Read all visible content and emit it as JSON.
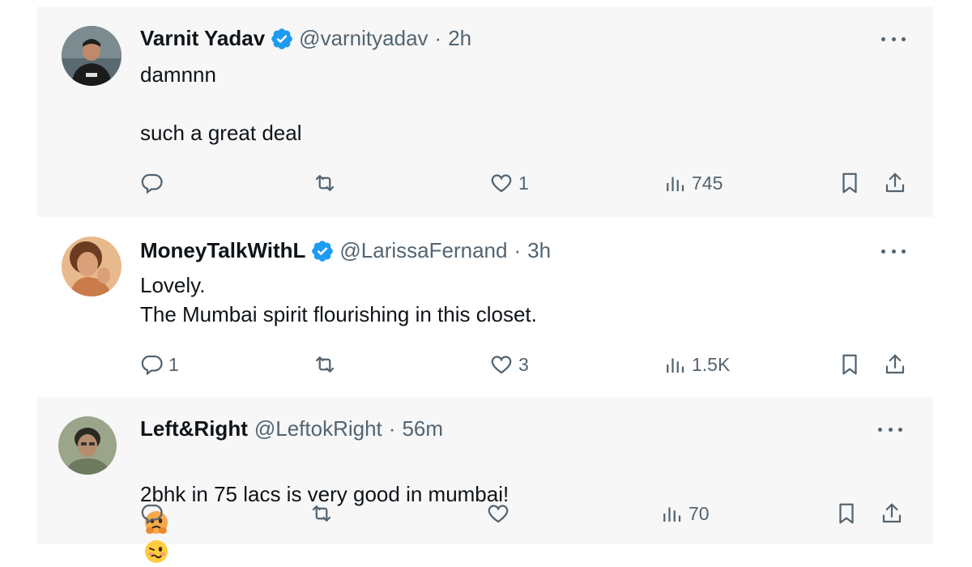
{
  "colors": {
    "text": "#0f1419",
    "secondary": "#536471",
    "verified_badge": "#1d9bf0",
    "row_bg": "#f7f7f7"
  },
  "tweets": [
    {
      "name": "Varnit Yadav",
      "verified": true,
      "handle": "@varnityadav",
      "separator": "·",
      "time": "2h",
      "text": "damnnn\n\nsuch a great deal",
      "replies": "",
      "retweets": "",
      "likes": "1",
      "views": "745",
      "avatar_icon": "person-dark-tshirt-avatar"
    },
    {
      "name": "MoneyTalkWithL",
      "verified": true,
      "handle": "@LarissaFernand",
      "separator": "·",
      "time": "3h",
      "text": "Lovely.\nThe Mumbai spirit flourishing in this closet.",
      "replies": "1",
      "retweets": "",
      "likes": "3",
      "views": "1.5K",
      "avatar_icon": "person-warm-tone-avatar"
    },
    {
      "name": "Left&Right",
      "verified": false,
      "handle": "@LeftokRight",
      "separator": "·",
      "time": "56m",
      "text": "2bhk in 75 lacs is very good in mumbai!",
      "emojis": [
        "face-holding-back-tears",
        "woozy-face"
      ],
      "replies": "",
      "retweets": "",
      "likes": "",
      "views": "70",
      "avatar_icon": "person-green-avatar"
    }
  ]
}
